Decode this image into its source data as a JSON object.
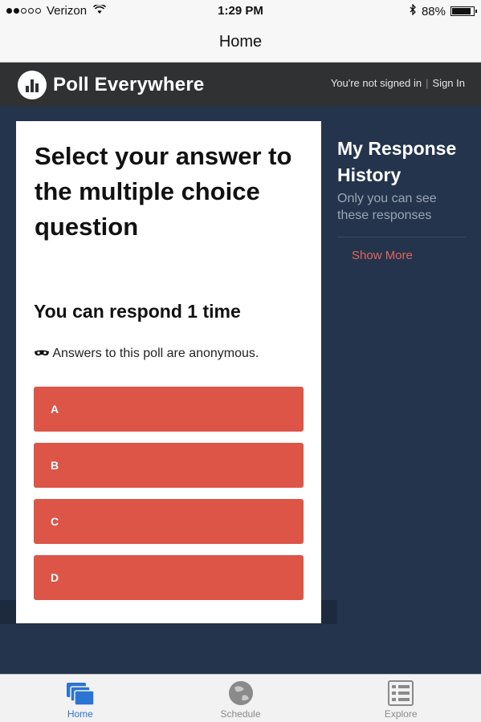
{
  "status_bar": {
    "carrier": "Verizon",
    "time": "1:29 PM",
    "battery": "88%",
    "battery_level": 0.88
  },
  "nav": {
    "title": "Home"
  },
  "header": {
    "logo_text": "Poll Everywhere",
    "not_signed_in": "You're not signed in",
    "separator": "|",
    "sign_in": "Sign In"
  },
  "poll": {
    "question": "Select your answer to the multiple choice question",
    "respond_limit": "You can respond 1 time",
    "anonymous_note": "Answers to this poll are anonymous.",
    "options": [
      "A",
      "B",
      "C",
      "D"
    ],
    "option_color": "#dc5547"
  },
  "history": {
    "title": "My Response History",
    "subtitle": "Only you can see these responses",
    "show_more": "Show More"
  },
  "tabs": [
    {
      "label": "Home",
      "icon": "home-stack-icon",
      "active": true
    },
    {
      "label": "Schedule",
      "icon": "globe-icon",
      "active": false
    },
    {
      "label": "Explore",
      "icon": "list-icon",
      "active": false
    }
  ],
  "colors": {
    "header_bg": "#2f3133",
    "main_bg": "#24344d",
    "accent": "#dc5547",
    "active_tab": "#2a74d4"
  }
}
